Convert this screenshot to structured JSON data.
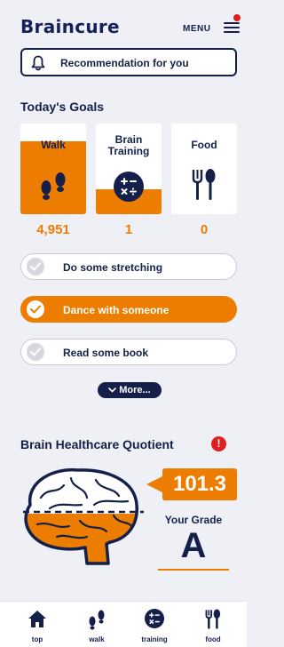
{
  "header": {
    "logo": "Braincure",
    "menu_label": "MENU",
    "recommendation_label": "Recommendation for you"
  },
  "goals": {
    "title": "Today's Goals",
    "cards": [
      {
        "label": "Walk",
        "count": "4,951",
        "icon": "footprints-icon",
        "fill_fraction": 0.8
      },
      {
        "label": "Brain Training",
        "count": "1",
        "icon": "calculator-icon",
        "fill_fraction": 0.27
      },
      {
        "label": "Food",
        "count": "0",
        "icon": "fork-spoon-icon",
        "fill_fraction": 0
      }
    ],
    "tasks": [
      {
        "label": "Do some stretching",
        "done": false
      },
      {
        "label": "Dance with someone",
        "done": true
      },
      {
        "label": "Read some book",
        "done": false
      }
    ],
    "more_label": "More..."
  },
  "bhq": {
    "title": "Brain Healthcare Quotient",
    "alert": "!",
    "score": "101.3",
    "grade_label": "Your Grade",
    "grade": "A"
  },
  "nav": {
    "items": [
      {
        "label": "top",
        "icon": "home-icon"
      },
      {
        "label": "walk",
        "icon": "footprints-icon"
      },
      {
        "label": "training",
        "icon": "calculator-icon"
      },
      {
        "label": "food",
        "icon": "fork-spoon-icon"
      }
    ]
  },
  "colors": {
    "accent": "#ec7d00",
    "navy": "#15204a",
    "alert": "#e02020",
    "background": "#eef0f6"
  }
}
